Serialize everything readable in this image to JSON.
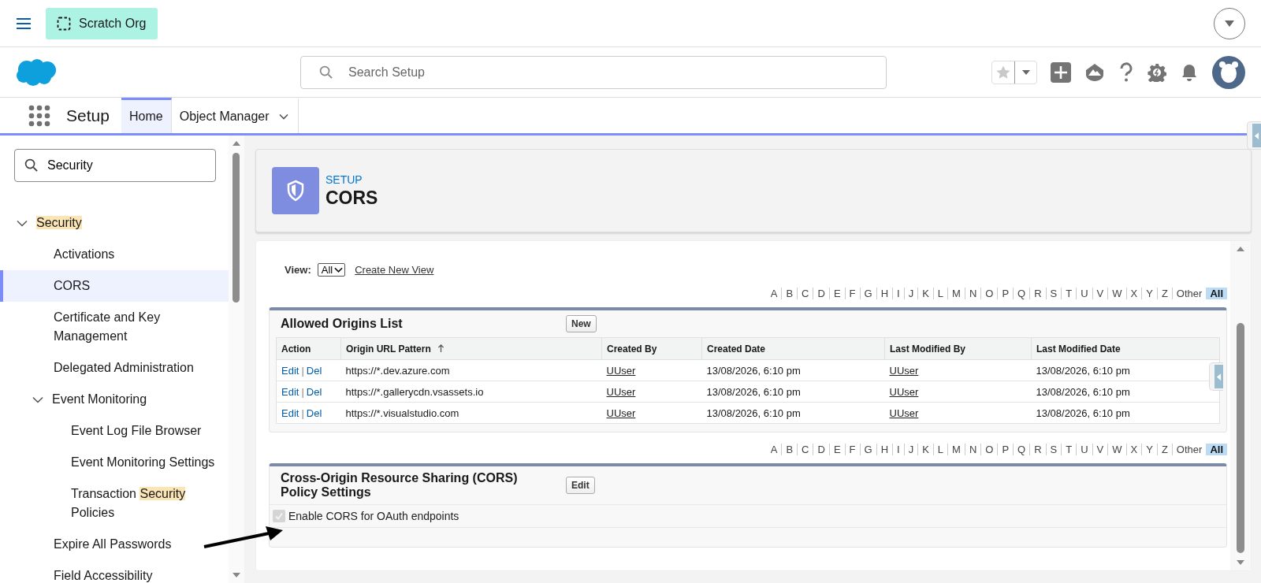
{
  "top_bar": {
    "org_badge": "Scratch Org"
  },
  "header": {
    "search": {
      "placeholder": "Search Setup"
    }
  },
  "nav": {
    "app_name": "Setup",
    "tabs": [
      {
        "label": "Home",
        "selected": true,
        "has_menu": false
      },
      {
        "label": "Object Manager",
        "selected": false,
        "has_menu": true
      }
    ]
  },
  "sidebar": {
    "search": {
      "value": "Security"
    },
    "tree": [
      {
        "segments": [
          {
            "text": "Security",
            "match": true
          }
        ],
        "selected": false,
        "expanded": true,
        "children": [
          {
            "segments": [
              {
                "text": "Activations",
                "match": false
              }
            ],
            "selected": false
          },
          {
            "segments": [
              {
                "text": "CORS",
                "match": false
              }
            ],
            "selected": true
          },
          {
            "segments": [
              {
                "text": "Certificate and Key Management",
                "match": false
              }
            ],
            "selected": false
          },
          {
            "segments": [
              {
                "text": "Delegated Administration",
                "match": false
              }
            ],
            "selected": false
          },
          {
            "segments": [
              {
                "text": "Event Monitoring",
                "match": false
              }
            ],
            "selected": false,
            "expanded": true,
            "children": [
              {
                "segments": [
                  {
                    "text": "Event Log File Browser",
                    "match": false
                  }
                ],
                "selected": false
              },
              {
                "segments": [
                  {
                    "text": "Event Monitoring Settings",
                    "match": false
                  }
                ],
                "selected": false
              },
              {
                "segments": [
                  {
                    "text": "Transaction ",
                    "match": false
                  },
                  {
                    "text": "Security",
                    "match": true
                  },
                  {
                    "text": " Policies",
                    "match": false
                  }
                ],
                "selected": false
              }
            ]
          },
          {
            "segments": [
              {
                "text": "Expire All Passwords",
                "match": false
              }
            ],
            "selected": false
          },
          {
            "segments": [
              {
                "text": "Field Accessibility",
                "match": false
              }
            ],
            "selected": false
          }
        ]
      }
    ]
  },
  "page_header": {
    "eyebrow": "SETUP",
    "title": "CORS"
  },
  "list_view": {
    "view_label": "View:",
    "view_select": "All",
    "create_view_link": "Create New View"
  },
  "alphabet_filters": [
    {
      "letters": [
        {
          "label": "A",
          "selected": false
        },
        {
          "label": "B",
          "selected": false
        },
        {
          "label": "C",
          "selected": false
        },
        {
          "label": "D",
          "selected": false
        },
        {
          "label": "E",
          "selected": false
        },
        {
          "label": "F",
          "selected": false
        },
        {
          "label": "G",
          "selected": false
        },
        {
          "label": "H",
          "selected": false
        },
        {
          "label": "I",
          "selected": false
        },
        {
          "label": "J",
          "selected": false
        },
        {
          "label": "K",
          "selected": false
        },
        {
          "label": "L",
          "selected": false
        },
        {
          "label": "M",
          "selected": false
        },
        {
          "label": "N",
          "selected": false
        },
        {
          "label": "O",
          "selected": false
        },
        {
          "label": "P",
          "selected": false
        },
        {
          "label": "Q",
          "selected": false
        },
        {
          "label": "R",
          "selected": false
        },
        {
          "label": "S",
          "selected": false
        },
        {
          "label": "T",
          "selected": false
        },
        {
          "label": "U",
          "selected": false
        },
        {
          "label": "V",
          "selected": false
        },
        {
          "label": "W",
          "selected": false
        },
        {
          "label": "X",
          "selected": false
        },
        {
          "label": "Y",
          "selected": false
        },
        {
          "label": "Z",
          "selected": false
        },
        {
          "label": "Other",
          "selected": false
        },
        {
          "label": "All",
          "selected": true
        }
      ]
    },
    {
      "letters": [
        {
          "label": "A",
          "selected": false
        },
        {
          "label": "B",
          "selected": false
        },
        {
          "label": "C",
          "selected": false
        },
        {
          "label": "D",
          "selected": false
        },
        {
          "label": "E",
          "selected": false
        },
        {
          "label": "F",
          "selected": false
        },
        {
          "label": "G",
          "selected": false
        },
        {
          "label": "H",
          "selected": false
        },
        {
          "label": "I",
          "selected": false
        },
        {
          "label": "J",
          "selected": false
        },
        {
          "label": "K",
          "selected": false
        },
        {
          "label": "L",
          "selected": false
        },
        {
          "label": "M",
          "selected": false
        },
        {
          "label": "N",
          "selected": false
        },
        {
          "label": "O",
          "selected": false
        },
        {
          "label": "P",
          "selected": false
        },
        {
          "label": "Q",
          "selected": false
        },
        {
          "label": "R",
          "selected": false
        },
        {
          "label": "S",
          "selected": false
        },
        {
          "label": "T",
          "selected": false
        },
        {
          "label": "U",
          "selected": false
        },
        {
          "label": "V",
          "selected": false
        },
        {
          "label": "W",
          "selected": false
        },
        {
          "label": "X",
          "selected": false
        },
        {
          "label": "Y",
          "selected": false
        },
        {
          "label": "Z",
          "selected": false
        },
        {
          "label": "Other",
          "selected": false
        },
        {
          "label": "All",
          "selected": true
        }
      ]
    }
  ],
  "origins_list": {
    "title": "Allowed Origins List",
    "new_button": "New",
    "columns": [
      {
        "label": "Action",
        "sorted_ascending": false
      },
      {
        "label": "Origin URL Pattern",
        "sorted_ascending": true
      },
      {
        "label": "Created By",
        "sorted_ascending": false
      },
      {
        "label": "Created Date",
        "sorted_ascending": false
      },
      {
        "label": "Last Modified By",
        "sorted_ascending": false
      },
      {
        "label": "Last Modified Date",
        "sorted_ascending": false
      }
    ],
    "rows": [
      {
        "edit": "Edit",
        "separator": "|",
        "delete": "Del",
        "origin": "https://*.dev.azure.com",
        "created_by": "UUser",
        "created_date": "13/08/2026, 6:10 pm",
        "last_modified_by": "UUser",
        "last_modified_date": "13/08/2026, 6:10 pm"
      },
      {
        "edit": "Edit",
        "separator": "|",
        "delete": "Del",
        "origin": "https://*.gallerycdn.vsassets.io",
        "created_by": "UUser",
        "created_date": "13/08/2026, 6:10 pm",
        "last_modified_by": "UUser",
        "last_modified_date": "13/08/2026, 6:10 pm"
      },
      {
        "edit": "Edit",
        "separator": "|",
        "delete": "Del",
        "origin": "https://*.visualstudio.com",
        "created_by": "UUser",
        "created_date": "13/08/2026, 6:10 pm",
        "last_modified_by": "UUser",
        "last_modified_date": "13/08/2026, 6:10 pm"
      }
    ]
  },
  "cors_settings": {
    "title": "Cross-Origin Resource Sharing (CORS) Policy Settings",
    "edit_button": "Edit",
    "options": [
      {
        "label": "Enable CORS for OAuth endpoints",
        "checked": true,
        "disabled": true
      }
    ]
  }
}
